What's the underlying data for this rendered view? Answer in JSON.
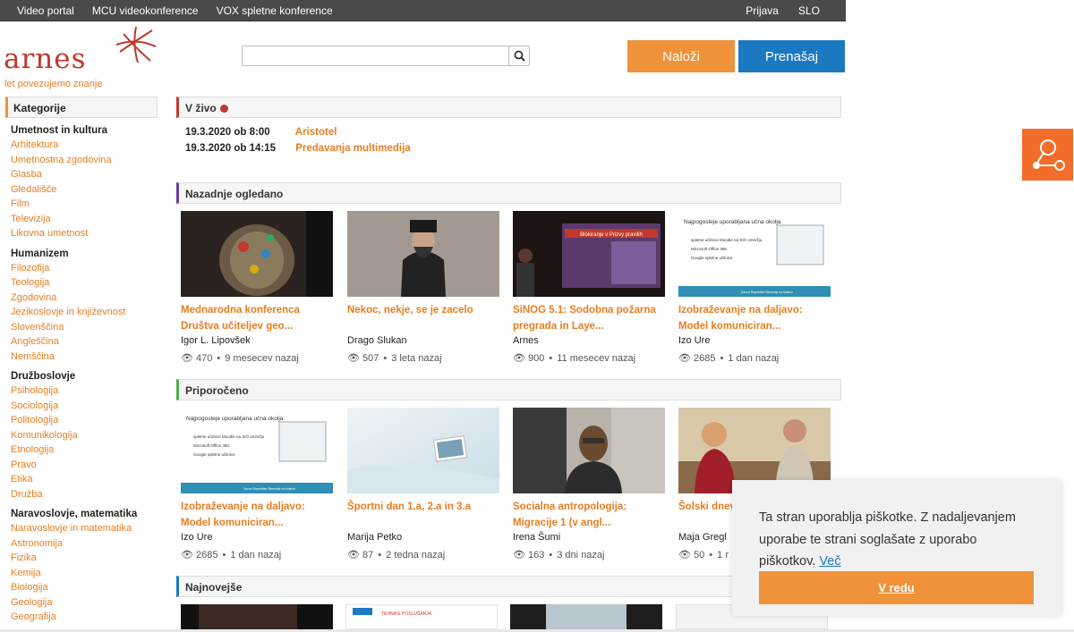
{
  "topnav": {
    "items": [
      "Video portal",
      "MCU videokonference",
      "VOX spletne konference"
    ],
    "login": "Prijava",
    "lang": "SLO"
  },
  "logo": {
    "text": "arnes",
    "tagline": "let povezujemo znanje"
  },
  "search": {
    "placeholder": "",
    "icon": "search-icon"
  },
  "buttons": {
    "upload": "Naloži",
    "stream": "Prenašaj"
  },
  "sidebar": {
    "heading": "Kategorije",
    "groups": [
      {
        "title": "Umetnost in kultura",
        "items": [
          "Arhitektura",
          "Umetnostna zgodovina",
          "Glasba",
          "Gledališče",
          "Film",
          "Televizija",
          "Likovna umetnost"
        ]
      },
      {
        "title": "Humanizem",
        "items": [
          "Filozofija",
          "Teologija",
          "Zgodovina",
          "Jezikoslovje in književnost",
          "Slovenščina",
          "Angleščina",
          "Nemščina"
        ]
      },
      {
        "title": "Družboslovje",
        "items": [
          "Psihologija",
          "Sociologija",
          "Politologija",
          "Komunikologija",
          "Etnologija",
          "Pravo",
          "Etika",
          "Družba"
        ]
      },
      {
        "title": "Naravoslovje, matematika",
        "items": [
          "Naravoslovje in matematika",
          "Astronomija",
          "Fizika",
          "Kemija",
          "Biologija",
          "Geologija",
          "Geografija"
        ]
      }
    ]
  },
  "live": {
    "heading": "V živo",
    "events": [
      {
        "datetime": "19.3.2020 ob 8:00",
        "title": "Aristotel"
      },
      {
        "datetime": "19.3.2020 ob 14:15",
        "title": "Predavanja multimedija"
      }
    ]
  },
  "recent": {
    "heading": "Nazadnje ogledano",
    "cards": [
      {
        "title": "Mednarodna konferenca Društva učiteljev geo...",
        "author": "Igor L. Lipovšek",
        "views": "470",
        "age": "9 mesecev nazaj"
      },
      {
        "title": "Nekoc, nekje, se je zacelo",
        "author": "Drago Slukan",
        "views": "507",
        "age": "3 leta nazaj"
      },
      {
        "title": "SiNOG 5.1: Sodobna požarna pregrada in Laye...",
        "author": "Arnes",
        "views": "900",
        "age": "11 mesecev nazaj"
      },
      {
        "title": "Izobraževanje na daljavo: Model komuniciran...",
        "author": "Izo Ure",
        "views": "2685",
        "age": "1 dan nazaj"
      }
    ]
  },
  "recommended": {
    "heading": "Priporočeno",
    "cards": [
      {
        "title": "Izobraževanje na daljavo: Model komuniciran...",
        "author": "Izo Ure",
        "views": "2685",
        "age": "1 dan nazaj"
      },
      {
        "title": "Športni dan 1.a, 2.a in 3.a",
        "author": "Marija Petko",
        "views": "87",
        "age": "2 tedna nazaj"
      },
      {
        "title": "Socialna antropologija: Migracije 1 (v angl...",
        "author": "Irena Šumi",
        "views": "163",
        "age": "3 dni nazaj"
      },
      {
        "title": "Šolski dnev",
        "author": "Maja Gregl",
        "views": "50",
        "age": "1 r"
      }
    ]
  },
  "newest": {
    "heading": "Najnovejše"
  },
  "thumb_text": {
    "slide_title": "Najpogosteje uporabljana učna okolja",
    "slide_b1": "spletne učilnice Moodle na SIO omrežju",
    "slide_b2": "Microsoft Office 365",
    "slide_b3": "Google spletne učilnice",
    "slide_footer": "Zavod Republike Slovenije za šolstvo",
    "sinog_banner": "Blokiranje v Prizvy pravilih",
    "newest_slide": "TEHNIKE POSLUŠANJA"
  },
  "cookie": {
    "message": "Ta stran uporablja piškotke. Z nadaljevanjem uporabe te strani soglašate z uporabo piškotkov.",
    "more": "Več",
    "ok": "V redu"
  },
  "colors": {
    "orange": "#f0923a",
    "blue": "#1a79c1",
    "red": "#c0392b"
  }
}
